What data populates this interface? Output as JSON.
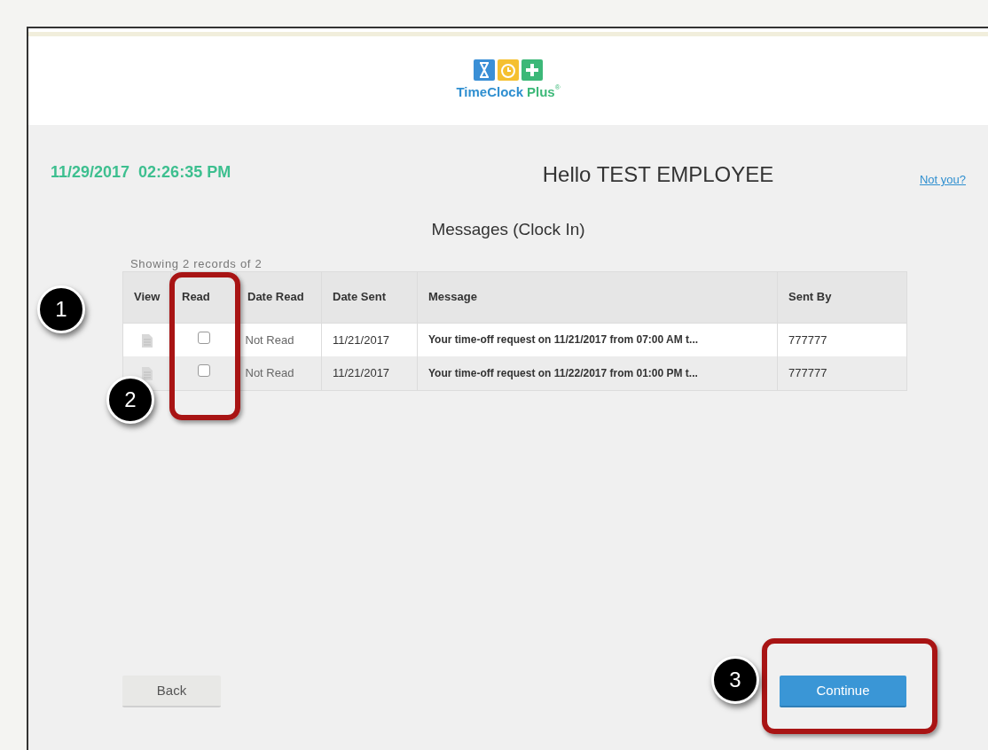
{
  "header": {
    "brand_primary": "TimeClock",
    "brand_secondary": "Plus",
    "brand_mark": "®"
  },
  "clock": "11/29/2017  02:26:35 PM",
  "greeting": "Hello TEST EMPLOYEE",
  "not_you_link": "Not you?",
  "subtitle": "Messages (Clock In)",
  "records_info": "Showing 2 records of 2",
  "table": {
    "columns": [
      "View",
      "Read",
      "Date Read",
      "Date Sent",
      "Message",
      "Sent By"
    ],
    "rows": [
      {
        "read": false,
        "date_read": "Not Read",
        "date_sent": "11/21/2017",
        "message": "Your time-off request on 11/21/2017 from 07:00 AM t...",
        "sent_by": "777777"
      },
      {
        "read": false,
        "date_read": "Not Read",
        "date_sent": "11/21/2017",
        "message": "Your time-off request on 11/22/2017 from 01:00 PM t...",
        "sent_by": "777777"
      }
    ]
  },
  "buttons": {
    "back": "Back",
    "continue": "Continue"
  },
  "callouts": [
    "1",
    "2",
    "3"
  ]
}
